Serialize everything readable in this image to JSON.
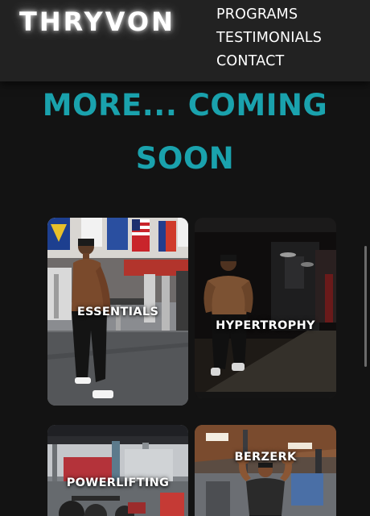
{
  "header": {
    "logo": "THRYVON",
    "nav": [
      "PROGRAMS",
      "TESTIMONIALS",
      "CONTACT"
    ]
  },
  "main": {
    "heading_line1": "MORE... COMING",
    "heading_line2": "SOON"
  },
  "programs": [
    {
      "label": "ESSENTIALS"
    },
    {
      "label": "HYPERTROPHY"
    },
    {
      "label": "POWERLIFTING"
    },
    {
      "label": "BERZERK"
    }
  ],
  "colors": {
    "accent": "#1aa2ad",
    "header_bg": "#222222",
    "page_bg": "#131313"
  }
}
